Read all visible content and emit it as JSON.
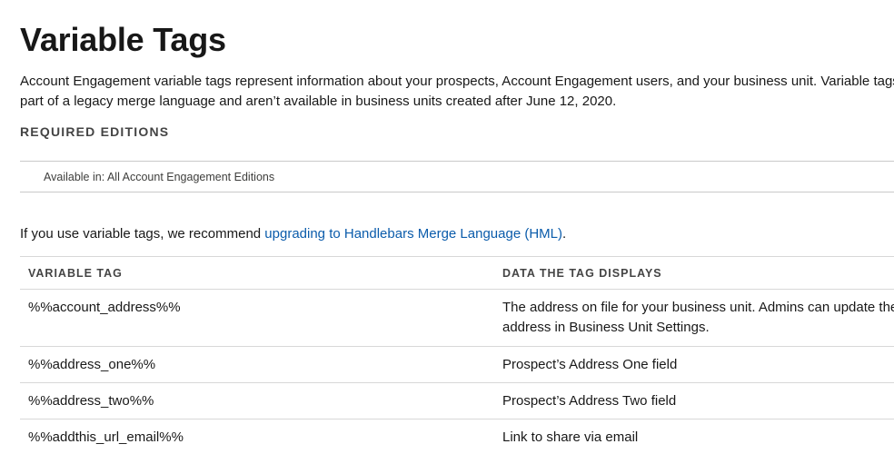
{
  "page": {
    "title": "Variable Tags"
  },
  "intro": {
    "line1": "Account Engagement variable tags represent information about your prospects, Account Engagement users, and your business unit. Variable tags are",
    "line2": "part of a legacy merge language and aren’t available in business units created after June 12, 2020."
  },
  "required_editions": {
    "heading": "REQUIRED EDITIONS",
    "text": "Available in: All Account Engagement Editions"
  },
  "recommend": {
    "prefix": "If you use variable tags, we recommend ",
    "link_text": "upgrading to Handlebars Merge Language (HML)",
    "suffix": "."
  },
  "table": {
    "headers": {
      "tag": "VARIABLE TAG",
      "desc": "DATA THE TAG DISPLAYS"
    },
    "rows": [
      {
        "tag": "%%account_address%%",
        "desc_line1": "The address on file for your business unit. Admins can update the",
        "desc_line2": "address in Business Unit Settings."
      },
      {
        "tag": "%%address_one%%",
        "desc_line1": "Prospect’s Address One field"
      },
      {
        "tag": "%%address_two%%",
        "desc_line1": "Prospect’s Address Two field"
      },
      {
        "tag": "%%addthis_url_email%%",
        "desc_line1": "Link to share via email"
      }
    ]
  },
  "colors": {
    "link": "#0b5cab",
    "text": "#181818",
    "muted": "#444444",
    "rule": "#d8d8d8"
  }
}
